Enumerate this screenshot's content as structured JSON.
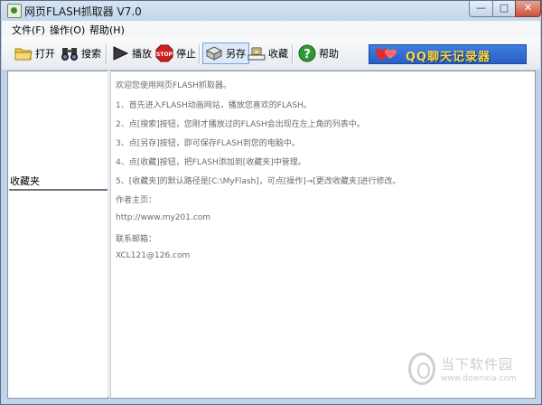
{
  "window": {
    "title": "网页FLASH抓取器 V7.0"
  },
  "window_controls": {
    "min": "—",
    "max": "□",
    "close": "✕"
  },
  "menu": [
    {
      "label": "文件(F)"
    },
    {
      "label": "操作(O)"
    },
    {
      "label": "帮助(H)"
    }
  ],
  "toolbar": {
    "open": "打开",
    "search": "搜索",
    "play": "播放",
    "stop": "停止",
    "save_as": "另存",
    "favorite": "收藏",
    "help": "帮助"
  },
  "banner": {
    "text": "QQ聊天记录器"
  },
  "left_pane": {
    "label": "收藏夹"
  },
  "content": {
    "lines": [
      "欢迎您使用网页FLASH抓取器。",
      "1、首先进入FLASH动画网站，播放您喜欢的FLASH。",
      "2、点[搜索]按钮，您刚才播放过的FLASH会出现在左上角的列表中。",
      "3、点[另存]按钮，即可保存FLASH到您的电脑中。",
      "4、点[收藏]按钮，把FLASH添加到[收藏夹]中管理。",
      "5、[收藏夹]的默认路径是[C:\\MyFlash]，可点[操作]→[更改收藏夹]进行修改。",
      "作者主页：",
      "http://www.my201.com",
      "联系邮箱：",
      "XCL121@126.com"
    ]
  },
  "watermark": {
    "name": "当下软件园",
    "url": "www.downxia.com"
  }
}
